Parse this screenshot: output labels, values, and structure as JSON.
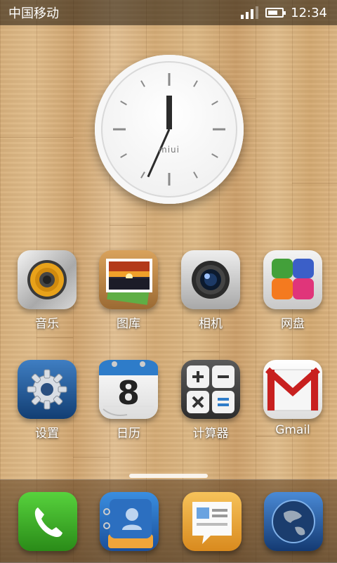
{
  "status_bar": {
    "carrier": "中国移动",
    "time": "12:34",
    "signal_bars": 4,
    "signal_active": 3,
    "battery_level": 0.7
  },
  "clock_widget": {
    "brand": "miui",
    "hour": 12,
    "minute": 34
  },
  "apps": [
    {
      "label": "音乐",
      "icon": "music-speaker-icon"
    },
    {
      "label": "图库",
      "icon": "gallery-icon"
    },
    {
      "label": "相机",
      "icon": "camera-icon"
    },
    {
      "label": "网盘",
      "icon": "cloud-drive-icon"
    },
    {
      "label": "设置",
      "icon": "settings-gear-icon"
    },
    {
      "label": "日历",
      "icon": "calendar-icon",
      "calendar_day": "8"
    },
    {
      "label": "计算器",
      "icon": "calculator-icon"
    },
    {
      "label": "Gmail",
      "icon": "gmail-icon"
    }
  ],
  "dock": [
    {
      "icon": "phone-icon"
    },
    {
      "icon": "contacts-icon"
    },
    {
      "icon": "messages-icon"
    },
    {
      "icon": "browser-globe-icon"
    }
  ],
  "colors": {
    "status_bar_bg": "#2a1c0e",
    "phone_green": "#2fa51e",
    "gmail_red": "#c8201f",
    "settings_blue": "#1e4f8a"
  }
}
